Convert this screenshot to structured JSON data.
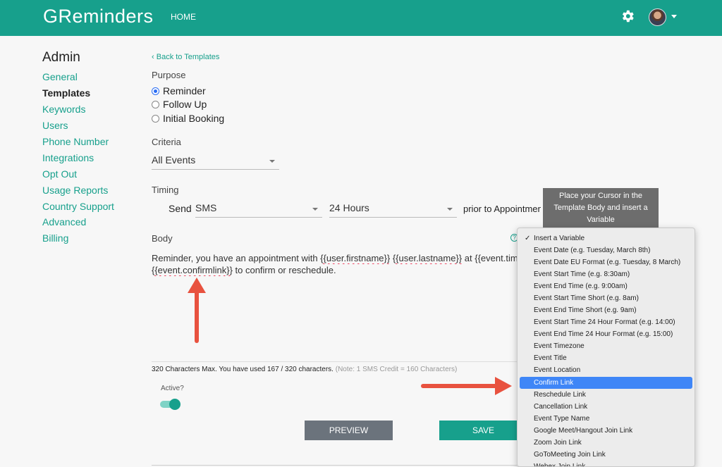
{
  "header": {
    "brand": "GReminders",
    "home_label": "HOME",
    "accent": "#17a08c"
  },
  "sidebar": {
    "title": "Admin",
    "items": [
      {
        "label": "General"
      },
      {
        "label": "Templates",
        "active": true
      },
      {
        "label": "Keywords"
      },
      {
        "label": "Users"
      },
      {
        "label": "Phone Number"
      },
      {
        "label": "Integrations"
      },
      {
        "label": "Opt Out"
      },
      {
        "label": "Usage Reports"
      },
      {
        "label": "Country Support"
      },
      {
        "label": "Advanced"
      },
      {
        "label": "Billing"
      }
    ]
  },
  "form": {
    "back_label": "Back to Templates",
    "purpose_label": "Purpose",
    "purpose_options": [
      "Reminder",
      "Follow Up",
      "Initial Booking"
    ],
    "purpose_selected": "Reminder",
    "criteria_label": "Criteria",
    "criteria_value": "All Events",
    "timing_label": "Timing",
    "send_label": "Send",
    "send_method": "SMS",
    "send_offset": "24 Hours",
    "prior_text": "prior to Appointment S",
    "body_label": "Body",
    "body_line1_pre": "Reminder, you have an appointment with ",
    "var_firstname": "{{user.firstname}}",
    "var_lastname": "{{user.lastname}}",
    "body_line1_mid": " at ",
    "body_line1_tail": "{{event.tim",
    "var_confirmlink": "{{event.confirmlink}}",
    "body_line2_post": " to confirm or reschedule.",
    "char_count": "320 Characters Max. You have used 167 / 320 characters.",
    "char_note": "(Note: 1 SMS Credit = 160 Characters)",
    "active_label": "Active?",
    "active_on": true,
    "preview_label": "PREVIEW",
    "save_label": "SAVE"
  },
  "tooltip": {
    "text": "Place your Cursor in the Template Body and insert a Variable"
  },
  "variable_menu": {
    "selected_label": "Confirm Link",
    "items": [
      "Insert a Variable",
      "Event Date (e.g. Tuesday, March 8th)",
      "Event Date EU Format (e.g. Tuesday, 8 March)",
      "Event Start Time (e.g. 8:30am)",
      "Event End Time (e.g. 9:00am)",
      "Event Start Time Short (e.g. 8am)",
      "Event End Time Short (e.g. 9am)",
      "Event Start Time 24 Hour Format (e.g. 14:00)",
      "Event End Time 24 Hour Format (e.g. 15:00)",
      "Event Timezone",
      "Event Title",
      "Event Location",
      "Confirm Link",
      "Reschedule Link",
      "Cancellation Link",
      "Event Type Name",
      "Google Meet/Hangout Join Link",
      "Zoom Join Link",
      "GoToMeeting Join Link",
      "Webex Join Link"
    ]
  },
  "annotations": {
    "arrow_color": "#e8523f"
  }
}
